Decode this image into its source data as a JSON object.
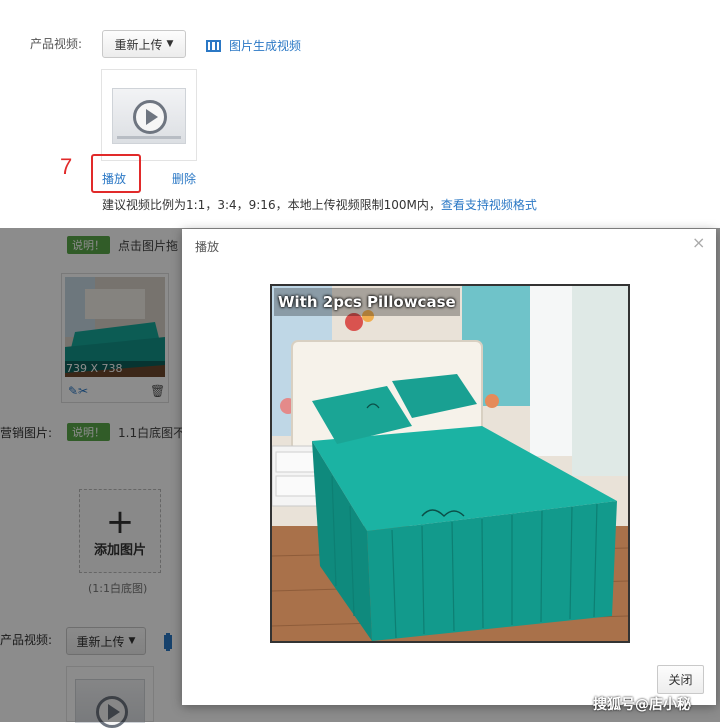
{
  "top": {
    "video_label": "产品视频:",
    "reupload_button": "重新上传",
    "generate_video_link": "图片生成视频",
    "play_link": "播放",
    "delete_link": "删除",
    "step_number": "7",
    "hint_text": "建议视频比例为1:1，3:4，9:16，本地上传视频限制100M内，",
    "formats_link": "查看支持视频格式"
  },
  "background": {
    "note_badge": "说明！",
    "note_text_1": "点击图片拖",
    "image_size": "739 X 738",
    "marketing_label": "营销图片:",
    "note_badge_2": "说明！",
    "note_text_2": "1.1白底图不",
    "add_image": "添加图片",
    "white_bg_caption": "(1:1白底图)",
    "video_label_2": "产品视频:",
    "reupload_button_2": "重新上传"
  },
  "modal": {
    "title": "播放",
    "close_icon": "×",
    "watermark_text": "With 2pcs Pillowcase",
    "close_button": "关闭"
  },
  "footer": {
    "watermark": "搜狐号@店小秘"
  },
  "colors": {
    "link": "#2b78c5",
    "highlight": "#e12a2a",
    "teal": "#17a89a"
  }
}
